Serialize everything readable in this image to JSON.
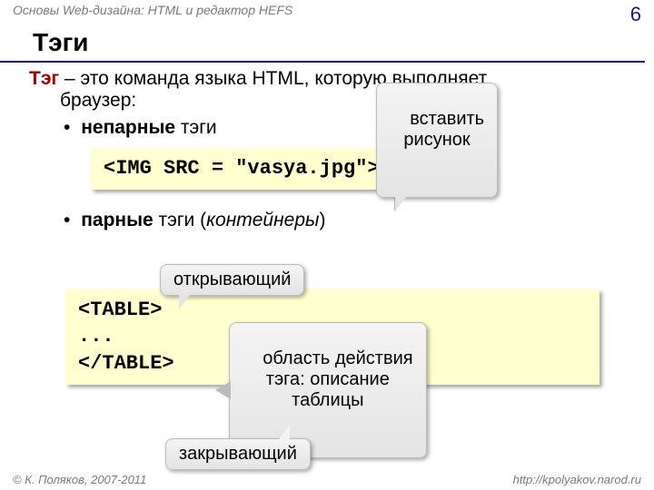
{
  "header": {
    "breadcrumb": "Основы Web-дизайна: HTML и редактор HEFS",
    "page_number": "6"
  },
  "title": "Тэги",
  "definition": {
    "term": "Тэг",
    "rest1": " – это команда языка HTML, которую выполняет",
    "rest2": "браузер:"
  },
  "bullets": {
    "unpaired": {
      "bold": "непарные",
      "rest": " тэги"
    },
    "paired": {
      "bold": "парные",
      "rest": " тэги (",
      "italic": "контейнеры",
      "rest2": ")"
    }
  },
  "code": {
    "img": "<IMG SRC = \"vasya.jpg\">",
    "table": "<TABLE>\n...\n</TABLE>"
  },
  "callouts": {
    "insert_img": "вставить\nрисунок",
    "opening": "открывающий",
    "scope": "область действия\nтэга: описание\nтаблицы",
    "closing": "закрывающий"
  },
  "footer": {
    "left": "© К. Поляков, 2007-2011",
    "right": "http://kpolyakov.narod.ru"
  }
}
